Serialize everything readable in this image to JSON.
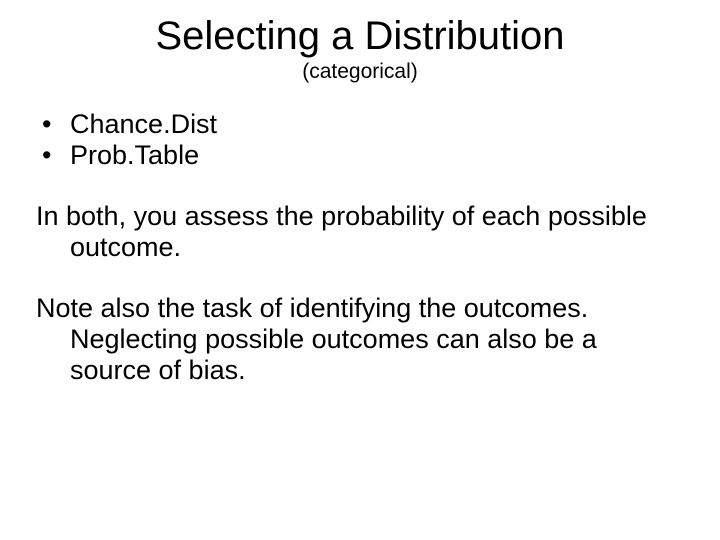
{
  "title": "Selecting a Distribution",
  "subtitle": "(categorical)",
  "bullets": [
    "Chance.Dist",
    "Prob.Table"
  ],
  "para1": "In both, you assess the probability of each possible outcome.",
  "para2": "Note also the task of identifying the outcomes.  Neglecting possible outcomes can also be a source of bias."
}
